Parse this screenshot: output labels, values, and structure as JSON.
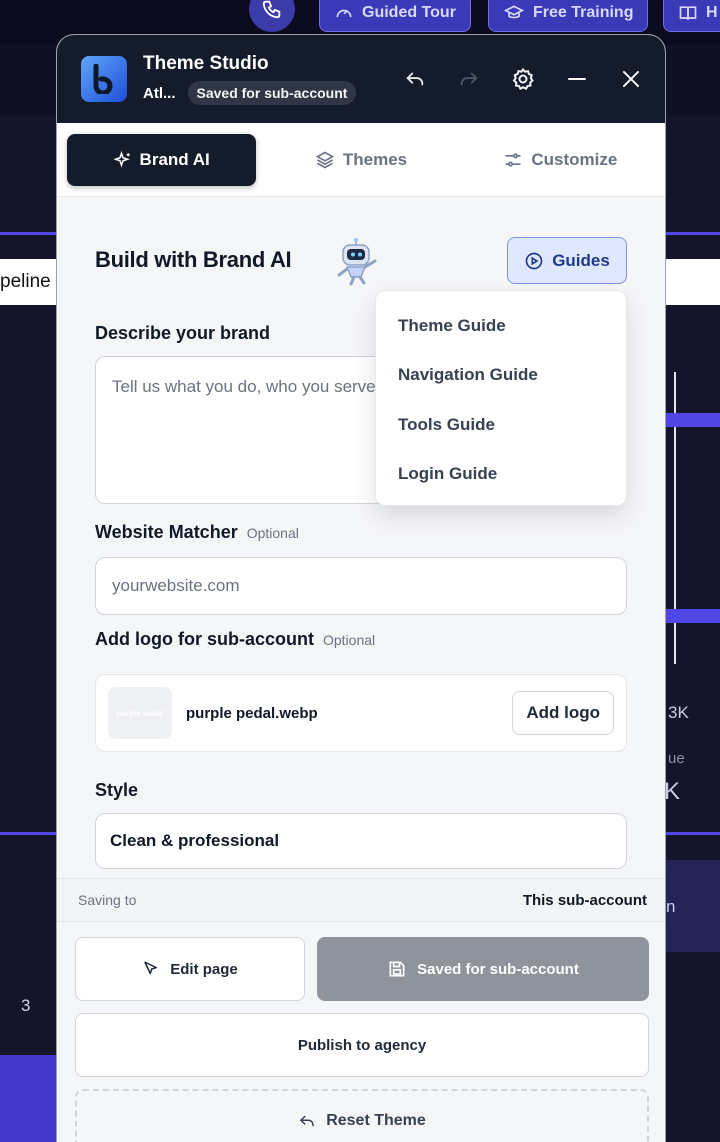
{
  "background": {
    "top_buttons": [
      {
        "label": "Guided Tour",
        "icon": "gauge-icon"
      },
      {
        "label": "Free Training",
        "icon": "graduation-cap-icon"
      },
      {
        "label": "H",
        "icon": "book-icon"
      }
    ],
    "pipeline_label": "peline",
    "right_values": [
      "3K",
      "ue",
      "K",
      "n"
    ],
    "left_value": "3"
  },
  "header": {
    "title": "Theme Studio",
    "account": "Atl...",
    "status": "Saved for sub-account"
  },
  "tabs": [
    {
      "label": "Brand AI",
      "icon": "sparkles-icon",
      "active": true
    },
    {
      "label": "Themes",
      "icon": "layers-icon",
      "active": false
    },
    {
      "label": "Customize",
      "icon": "sliders-icon",
      "active": false
    }
  ],
  "main": {
    "heading": "Build with Brand AI",
    "guides_label": "Guides",
    "describe_label": "Describe your brand",
    "describe_placeholder": "Tell us what you do, who you serve, and the feeling you want...",
    "website_label": "Website Matcher",
    "website_optional": "Optional",
    "website_placeholder": "yourwebsite.com",
    "logo_label": "Add logo for sub-account",
    "logo_optional": "Optional",
    "logo_file": "purple pedal.webp",
    "logo_thumb_text": "purple pedal",
    "add_logo_label": "Add logo",
    "style_label": "Style",
    "style_value": "Clean & professional"
  },
  "guides_menu": [
    "Theme Guide",
    "Navigation Guide",
    "Tools Guide",
    "Login Guide"
  ],
  "footer": {
    "saving_label": "Saving to",
    "saving_value": "This sub-account",
    "edit_label": "Edit page",
    "saved_label": "Saved for sub-account",
    "publish_label": "Publish to agency",
    "reset_label": "Reset Theme"
  },
  "colors": {
    "header_bg": "#141b2b",
    "accent": "#4f46e5",
    "guides_bg": "#e0e8ff",
    "saved_button": "#8f949c"
  }
}
